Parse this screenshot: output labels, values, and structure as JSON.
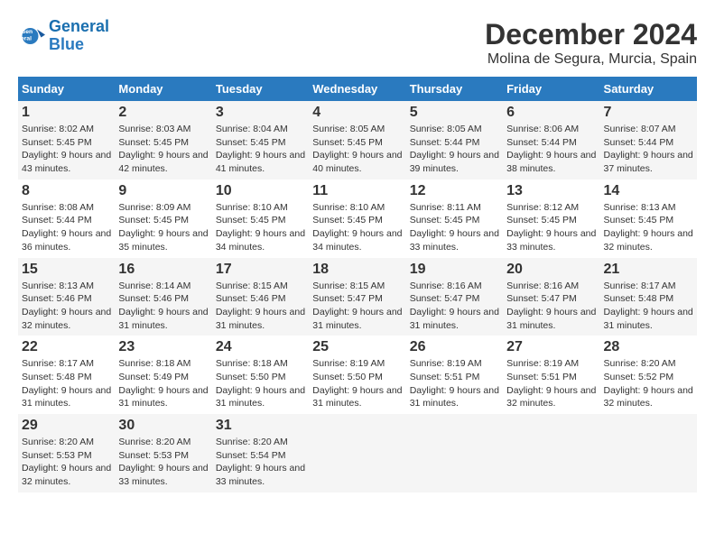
{
  "logo": {
    "line1": "General",
    "line2": "Blue"
  },
  "title": "December 2024",
  "location": "Molina de Segura, Murcia, Spain",
  "days_of_week": [
    "Sunday",
    "Monday",
    "Tuesday",
    "Wednesday",
    "Thursday",
    "Friday",
    "Saturday"
  ],
  "weeks": [
    [
      {
        "day": "1",
        "sunrise": "8:02 AM",
        "sunset": "5:45 PM",
        "daylight": "9 hours and 43 minutes."
      },
      {
        "day": "2",
        "sunrise": "8:03 AM",
        "sunset": "5:45 PM",
        "daylight": "9 hours and 42 minutes."
      },
      {
        "day": "3",
        "sunrise": "8:04 AM",
        "sunset": "5:45 PM",
        "daylight": "9 hours and 41 minutes."
      },
      {
        "day": "4",
        "sunrise": "8:05 AM",
        "sunset": "5:45 PM",
        "daylight": "9 hours and 40 minutes."
      },
      {
        "day": "5",
        "sunrise": "8:05 AM",
        "sunset": "5:44 PM",
        "daylight": "9 hours and 39 minutes."
      },
      {
        "day": "6",
        "sunrise": "8:06 AM",
        "sunset": "5:44 PM",
        "daylight": "9 hours and 38 minutes."
      },
      {
        "day": "7",
        "sunrise": "8:07 AM",
        "sunset": "5:44 PM",
        "daylight": "9 hours and 37 minutes."
      }
    ],
    [
      {
        "day": "8",
        "sunrise": "8:08 AM",
        "sunset": "5:44 PM",
        "daylight": "9 hours and 36 minutes."
      },
      {
        "day": "9",
        "sunrise": "8:09 AM",
        "sunset": "5:45 PM",
        "daylight": "9 hours and 35 minutes."
      },
      {
        "day": "10",
        "sunrise": "8:10 AM",
        "sunset": "5:45 PM",
        "daylight": "9 hours and 34 minutes."
      },
      {
        "day": "11",
        "sunrise": "8:10 AM",
        "sunset": "5:45 PM",
        "daylight": "9 hours and 34 minutes."
      },
      {
        "day": "12",
        "sunrise": "8:11 AM",
        "sunset": "5:45 PM",
        "daylight": "9 hours and 33 minutes."
      },
      {
        "day": "13",
        "sunrise": "8:12 AM",
        "sunset": "5:45 PM",
        "daylight": "9 hours and 33 minutes."
      },
      {
        "day": "14",
        "sunrise": "8:13 AM",
        "sunset": "5:45 PM",
        "daylight": "9 hours and 32 minutes."
      }
    ],
    [
      {
        "day": "15",
        "sunrise": "8:13 AM",
        "sunset": "5:46 PM",
        "daylight": "9 hours and 32 minutes."
      },
      {
        "day": "16",
        "sunrise": "8:14 AM",
        "sunset": "5:46 PM",
        "daylight": "9 hours and 31 minutes."
      },
      {
        "day": "17",
        "sunrise": "8:15 AM",
        "sunset": "5:46 PM",
        "daylight": "9 hours and 31 minutes."
      },
      {
        "day": "18",
        "sunrise": "8:15 AM",
        "sunset": "5:47 PM",
        "daylight": "9 hours and 31 minutes."
      },
      {
        "day": "19",
        "sunrise": "8:16 AM",
        "sunset": "5:47 PM",
        "daylight": "9 hours and 31 minutes."
      },
      {
        "day": "20",
        "sunrise": "8:16 AM",
        "sunset": "5:47 PM",
        "daylight": "9 hours and 31 minutes."
      },
      {
        "day": "21",
        "sunrise": "8:17 AM",
        "sunset": "5:48 PM",
        "daylight": "9 hours and 31 minutes."
      }
    ],
    [
      {
        "day": "22",
        "sunrise": "8:17 AM",
        "sunset": "5:48 PM",
        "daylight": "9 hours and 31 minutes."
      },
      {
        "day": "23",
        "sunrise": "8:18 AM",
        "sunset": "5:49 PM",
        "daylight": "9 hours and 31 minutes."
      },
      {
        "day": "24",
        "sunrise": "8:18 AM",
        "sunset": "5:50 PM",
        "daylight": "9 hours and 31 minutes."
      },
      {
        "day": "25",
        "sunrise": "8:19 AM",
        "sunset": "5:50 PM",
        "daylight": "9 hours and 31 minutes."
      },
      {
        "day": "26",
        "sunrise": "8:19 AM",
        "sunset": "5:51 PM",
        "daylight": "9 hours and 31 minutes."
      },
      {
        "day": "27",
        "sunrise": "8:19 AM",
        "sunset": "5:51 PM",
        "daylight": "9 hours and 32 minutes."
      },
      {
        "day": "28",
        "sunrise": "8:20 AM",
        "sunset": "5:52 PM",
        "daylight": "9 hours and 32 minutes."
      }
    ],
    [
      {
        "day": "29",
        "sunrise": "8:20 AM",
        "sunset": "5:53 PM",
        "daylight": "9 hours and 32 minutes."
      },
      {
        "day": "30",
        "sunrise": "8:20 AM",
        "sunset": "5:53 PM",
        "daylight": "9 hours and 33 minutes."
      },
      {
        "day": "31",
        "sunrise": "8:20 AM",
        "sunset": "5:54 PM",
        "daylight": "9 hours and 33 minutes."
      },
      null,
      null,
      null,
      null
    ]
  ]
}
